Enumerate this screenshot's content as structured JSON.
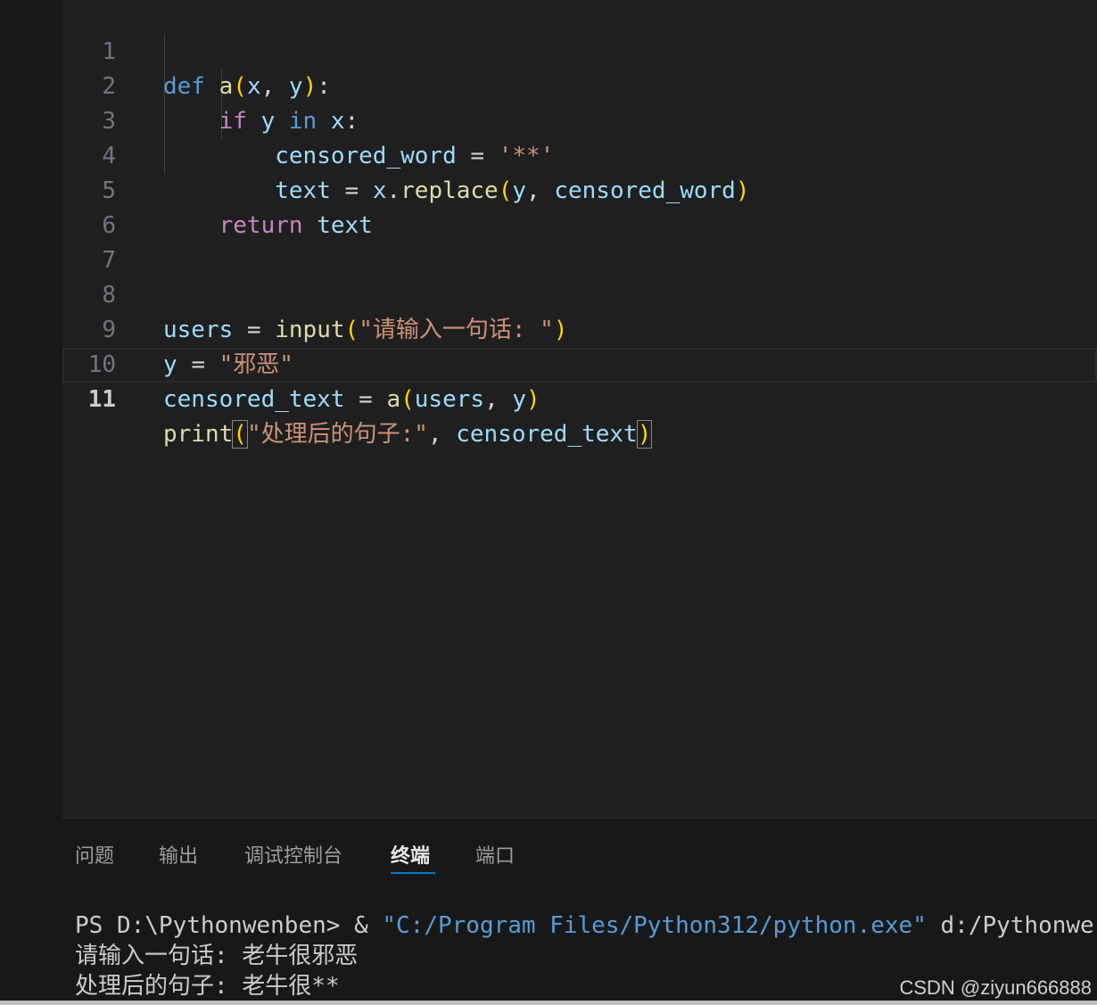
{
  "editor": {
    "line_numbers": [
      "1",
      "2",
      "3",
      "4",
      "5",
      "6",
      "7",
      "8",
      "9",
      "10",
      "11"
    ],
    "tokens": {
      "l1": [
        "def",
        "a",
        "(",
        "x",
        ", ",
        "y",
        ")",
        ":"
      ],
      "l2": [
        "if",
        "y",
        "in",
        "x",
        ":"
      ],
      "l3": [
        "censored_word",
        "=",
        "'**'"
      ],
      "l4": [
        "text",
        "=",
        "x",
        ".",
        "replace",
        "(",
        "y",
        ", ",
        "censored_word",
        ")"
      ],
      "l5": [
        "return",
        "text"
      ],
      "l8": [
        "users",
        "=",
        "input",
        "(",
        "\"请输入一句话: \"",
        ")"
      ],
      "l9": [
        "y",
        "=",
        "\"邪恶\""
      ],
      "l10": [
        "censored_text",
        "=",
        "a",
        "(",
        "users",
        ", ",
        "y",
        ")"
      ],
      "l11": [
        "print",
        "(",
        "\"处理后的句子:\"",
        ", ",
        "censored_text",
        ")"
      ]
    }
  },
  "panel": {
    "tabs": [
      "问题",
      "输出",
      "调试控制台",
      "终端",
      "端口"
    ],
    "active_tab": "终端",
    "terminal": {
      "prompt": "PS D:\\Pythonwenben> & ",
      "exe_path": "\"C:/Program Files/Python312/python.exe\"",
      "script_path": " d:/Pythonwer",
      "input_line": "请输入一句话: 老牛很邪恶",
      "output_line": "处理后的句子: 老牛很**"
    }
  },
  "watermark": "CSDN @ziyun666888",
  "colors": {
    "background": "#1f1f1f",
    "keyword": "#569cd6",
    "control": "#c586c0",
    "function": "#dcdcaa",
    "variable": "#9cdcfe",
    "string": "#ce9178",
    "bracket1": "#ffd700",
    "bracket2": "#da70d6",
    "active_tab_underline": "#0078d4"
  }
}
